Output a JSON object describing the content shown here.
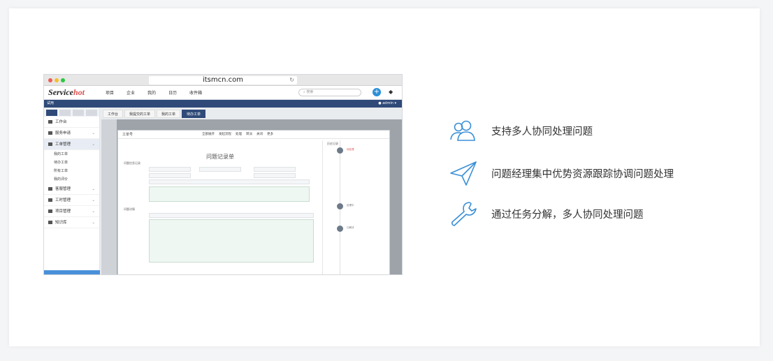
{
  "browser": {
    "url": "itsmcn.com",
    "app": {
      "logo_first": "S",
      "logo_main": "ervice",
      "logo_accent": "hot",
      "nav": [
        "项目",
        "企业",
        "我的",
        "日历",
        "收件箱"
      ],
      "search_placeholder": "搜索",
      "trial_label": "试用",
      "user": "admin",
      "sidebar": {
        "items": [
          {
            "label": "工作台"
          },
          {
            "label": "服务申请"
          },
          {
            "label": "工单管理"
          },
          {
            "label": "客服管理"
          },
          {
            "label": "工时管理"
          },
          {
            "label": "项目管理"
          },
          {
            "label": "知识库"
          }
        ],
        "subitems": [
          "我的工单",
          "待办工单",
          "所有工单",
          "我的评价"
        ]
      },
      "tabs": [
        "工作台",
        "我提交的工单",
        "我的工单",
        "待办工单"
      ],
      "dialog": {
        "top_left": "工单号",
        "actions": [
          "全部展开",
          "发起流程",
          "处理",
          "转派",
          "关闭",
          "更多"
        ],
        "form_title": "问题记录单",
        "section1": "问题信息记录",
        "section2": "问题详情",
        "timeline_header": "历史记录",
        "timeline_entries": [
          "待处理",
          "处理中",
          "已解决"
        ]
      }
    }
  },
  "features": [
    {
      "icon": "users-icon",
      "label": "支持多人协同处理问题"
    },
    {
      "icon": "paper-plane-icon",
      "label": "问题经理集中优势资源跟踪协调问题处理"
    },
    {
      "icon": "wrench-icon",
      "label": "通过任务分解，多人协同处理问题"
    }
  ],
  "colors": {
    "accent": "#2b8fd9",
    "navy": "#2f4a78",
    "logo_red": "#d9534f"
  }
}
